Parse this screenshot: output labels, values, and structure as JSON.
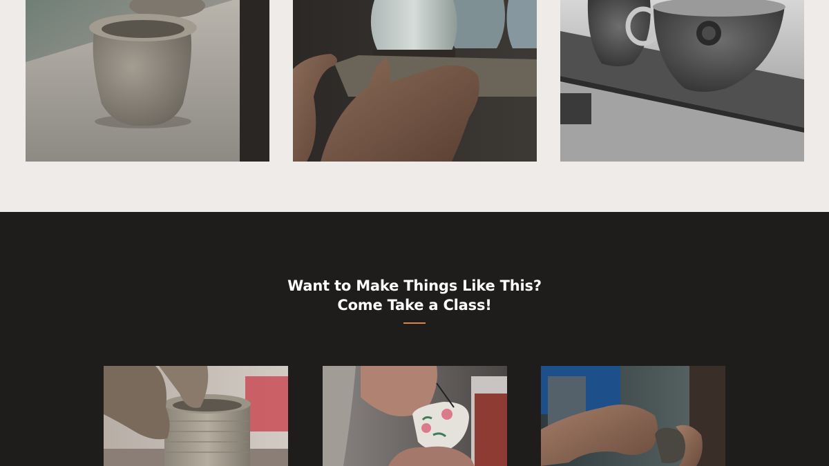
{
  "gallery": {
    "images": [
      {
        "subject": "clay-pot-on-shelf"
      },
      {
        "subject": "hands-holding-glazed-vase"
      },
      {
        "subject": "carved-bowls-on-shelf"
      }
    ]
  },
  "classes": {
    "heading_line1": "Want to Make Things Like This?",
    "heading_line2": "Come Take a Class!",
    "accent_color": "#d9884a",
    "images": [
      {
        "subject": "hands-throwing-clay-on-wheel"
      },
      {
        "subject": "hands-painting-cup"
      },
      {
        "subject": "hands-shaping-small-pot"
      }
    ]
  },
  "colors": {
    "page_background": "#efebe8",
    "dark_section": "#1e1d1c",
    "heading_text": "#ffffff"
  }
}
